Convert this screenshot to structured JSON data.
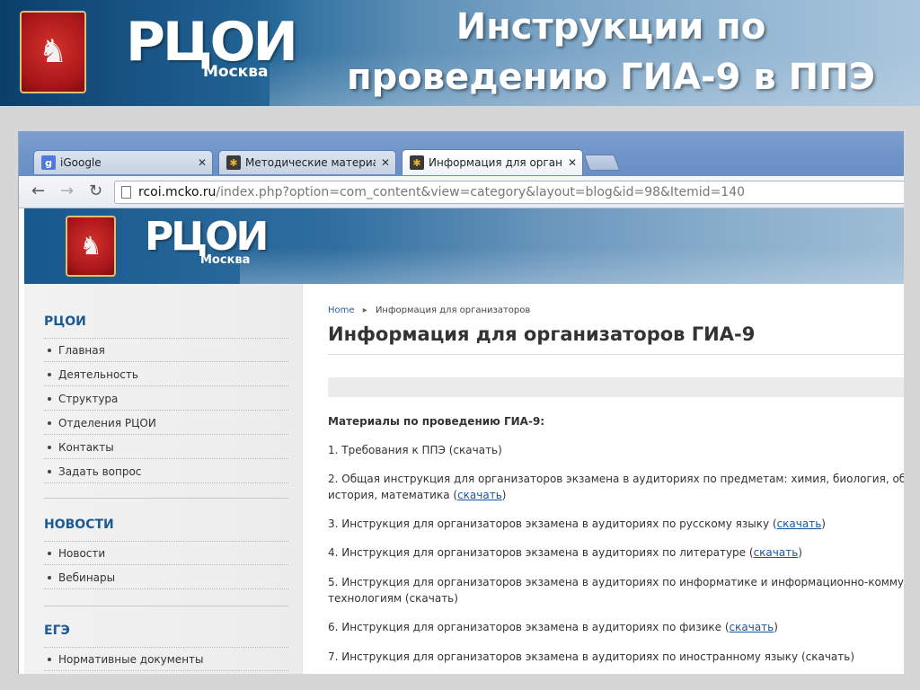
{
  "slide": {
    "title_line1": "Инструкции по",
    "title_line2": "проведению ГИА-9 в ППЭ",
    "logo_text": "РЦОИ",
    "logo_subtext": "Москва"
  },
  "browser": {
    "tabs": [
      {
        "label": "iGoogle",
        "icon": "google-icon"
      },
      {
        "label": "Методические материал",
        "icon": "joomla-icon"
      },
      {
        "label": "Информация для органи",
        "icon": "joomla-icon"
      }
    ],
    "address": {
      "host": "rcoi.mcko.ru",
      "path": "/index.php?option=com_content&view=category&layout=blog&id=98&Itemid=140"
    }
  },
  "site": {
    "logo_text": "РЦОИ",
    "logo_subtext": "Москва"
  },
  "sidebar": {
    "sections": [
      {
        "heading": "РЦОИ",
        "items": [
          "Главная",
          "Деятельность",
          "Структура",
          "Отделения РЦОИ",
          "Контакты",
          "Задать вопрос"
        ]
      },
      {
        "heading": "НОВОСТИ",
        "items": [
          "Новости",
          "Вебинары"
        ]
      },
      {
        "heading": "ЕГЭ",
        "items": [
          "Нормативные документы"
        ]
      }
    ]
  },
  "main": {
    "breadcrumb_home": "Home",
    "breadcrumb_sep": "▸",
    "breadcrumb_current": "Информация для организаторов",
    "title": "Информация для организаторов ГИА-9",
    "intro": "Материалы по проведению ГИА-9:",
    "download": "скачать",
    "items": {
      "i1": "1. Требования к ППЭ (скачать)",
      "i2_line1": "2. Общая инструкция для организаторов экзамена в аудиториях по предметам: химия, биология, об",
      "i2_line2": "история, математика",
      "i3": "3. Инструкция для организаторов экзамена в аудиториях по русскому языку",
      "i4": "4. Инструкция для организаторов экзамена в аудиториях по литературе",
      "i5_line1": "5. Инструкция для организаторов экзамена в аудиториях по информатике и информационно-комму",
      "i5_line2": "технологиям (скачать)",
      "i6": "6. Инструкция для организаторов экзамена в аудиториях по физике",
      "i7": "7. Инструкция для организаторов экзамена в аудиториях по иностранному языку (скачать)"
    }
  },
  "colors": {
    "brand_blue": "#1c5a94",
    "link": "#1a55a3",
    "coat_red": "#b3181c"
  }
}
